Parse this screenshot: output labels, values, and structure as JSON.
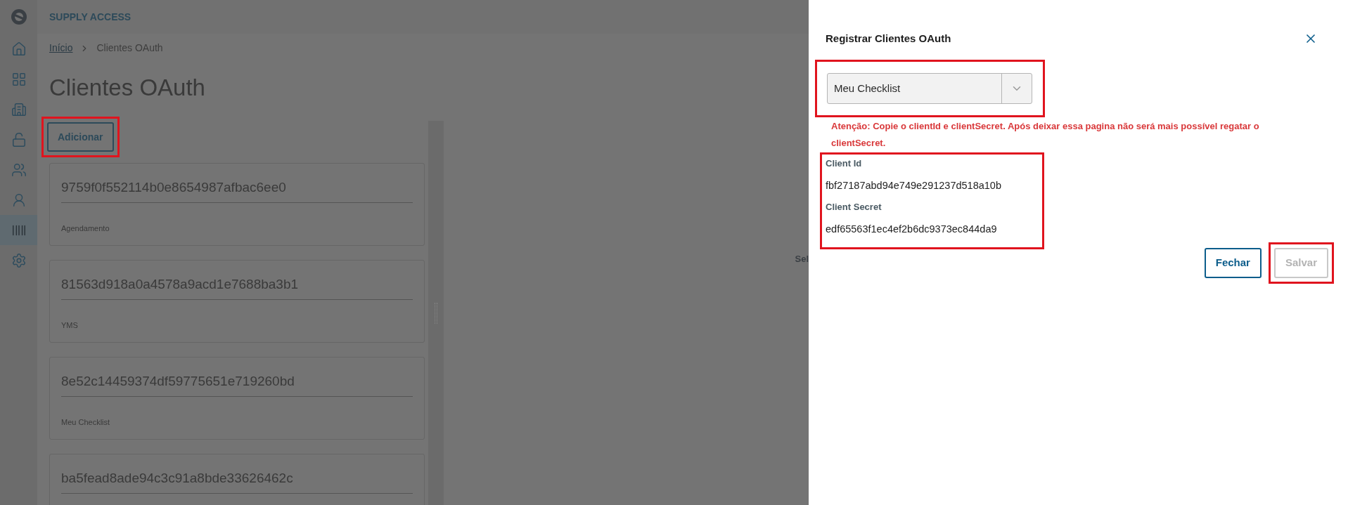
{
  "app": {
    "name": "SUPPLY ACCESS"
  },
  "sidebar": {
    "items": [
      {
        "selected": false
      },
      {
        "selected": false
      },
      {
        "selected": false
      },
      {
        "selected": false
      },
      {
        "selected": false
      },
      {
        "selected": false
      },
      {
        "selected": true
      },
      {
        "selected": false
      }
    ]
  },
  "breadcrumb": [
    {
      "label": "Início",
      "kind": "link"
    },
    {
      "label": "Clientes OAuth",
      "kind": "current"
    }
  ],
  "page_title": "Clientes OAuth",
  "add_button": {
    "label": "Adicionar",
    "highlighted": true
  },
  "clients": [
    {
      "client_id": "9759f0f552114b0e8654987afbac6ee0",
      "name": "Agendamento"
    },
    {
      "client_id": "81563d918a0a4578a9acd1e7688ba3b1",
      "name": "YMS"
    },
    {
      "client_id": "8e52c14459374df59775651e719260bd",
      "name": "Meu Checklist"
    },
    {
      "client_id": "ba5fead8ade94c3c91a8bde33626462c"
    }
  ],
  "detail_pane": {
    "text": "Sel"
  },
  "dialog": {
    "title": "Registrar Clientes OAuth",
    "select": {
      "value": "Meu Checklist",
      "highlighted": true
    },
    "warning": "Atenção: Copie o clientId e clientSecret. Após deixar essa pagina não será mais possível regatar o clientSecret.",
    "credentials": {
      "highlighted": true,
      "fields": [
        {
          "label": "Client Id",
          "value": "fbf27187abd94e749e291237d518a10b"
        },
        {
          "label": "Client Secret",
          "value": "edf65563f1ec4ef2b6dc9373ec844da9"
        }
      ]
    },
    "buttons": [
      {
        "label": "Fechar",
        "disabled": false,
        "highlighted": false
      },
      {
        "label": "Salvar",
        "disabled": true,
        "highlighted": true
      }
    ]
  }
}
